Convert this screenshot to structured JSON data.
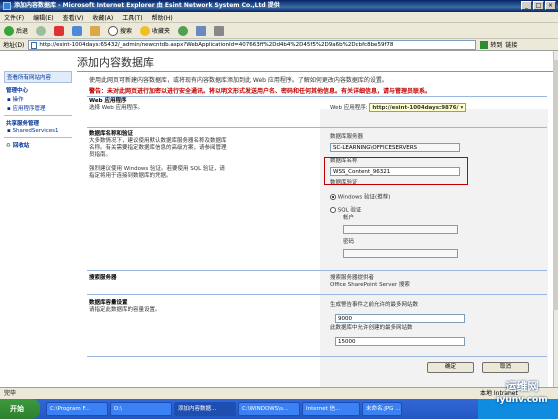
{
  "window": {
    "title": "添加内容数据库 - Microsoft Internet Explorer 由 Esint Network System Co.,Ltd 提供",
    "minimize": "_",
    "maximize": "□",
    "close": "×"
  },
  "menu": [
    "文件(F)",
    "编辑(E)",
    "查看(V)",
    "收藏(A)",
    "工具(T)",
    "帮助(H)"
  ],
  "toolbar": {
    "back": "后退",
    "search": "搜索",
    "favorites": "收藏夹"
  },
  "address": {
    "label": "地址(D)",
    "url": "http://esint-1004days:65432/_admin/newcntdb.aspx?WebApplicationId=407663ff%2Dd4b4%2D45f5%2D9a6b%2Dcbfc8be59f78",
    "go": "转到",
    "links": "链接"
  },
  "page": {
    "title": "添加内容数据库",
    "description": "使用此网页可新建内容数据库，或将现有内容数据库添加到此 Web 应用程序。了解如何更改内容数据库的设置。",
    "warning": "警告：未对此网页进行加密以进行安全通讯。将以明文形式发送用户名、密码和任何其他信息。有关详细信息，请与管理员联系。"
  },
  "leftnav": {
    "view_all": "查看所有网站内容",
    "central_admin": "管理中心",
    "operations": "操作",
    "app_management": "应用程序管理",
    "shared_services_header": "共享服务管理",
    "shared_services": "SharedServices1",
    "recycle_bin": "回收站"
  },
  "sections": {
    "webapp": {
      "title": "Web 应用程序",
      "desc": "选择 Web 应用程序。",
      "label": "Web 应用程序:",
      "value": "http://esint-1004days:9876/"
    },
    "db": {
      "title": "数据库名称和验证",
      "desc": "大多数情况下，建议使用默认数据库服务器名称及数据库名称。有关需要指定数据库信息的高级方案，请参阅管理员指南。",
      "desc2": "强烈建议使用 Windows 验证。若要使用 SQL 验证，请指定将用于连接到数据库的凭据。",
      "server_label": "数据库服务器",
      "server_value": "SC-LEARNING\\OFFICESERVERS",
      "name_label": "数据库名称",
      "name_value": "WSS_Content_96321",
      "auth_label": "数据库验证",
      "windows_auth": "Windows 验证(推荐)",
      "sql_auth": "SQL 验证",
      "account": "帐户",
      "password": "密码"
    },
    "search": {
      "title": "搜索服务器",
      "provider_label": "搜索服务器提供者",
      "provider_value": "Office SharePoint Server 搜索"
    },
    "capacity": {
      "title": "数据库容量设置",
      "desc": "请指定此数据库的容量设置。",
      "warn_label": "生成警告事件之前允许的最多网站数",
      "warn_value": "9000",
      "max_label": "此数据库中允许创建的最多网站数",
      "max_value": "15000"
    }
  },
  "buttons": {
    "ok": "确定",
    "cancel": "取消"
  },
  "status": {
    "text": "完毕",
    "zone": "本地 Intranet"
  },
  "taskbar": {
    "start": "开始",
    "tasks": [
      "C:\\Program F...",
      "D:\\",
      "添加内容数据...",
      "C:\\WINDOWS\\s...",
      "Internet 信...",
      "未命名.JPG ..."
    ]
  },
  "watermark": {
    "line1": "运维网",
    "line2": "iyunv.com"
  }
}
